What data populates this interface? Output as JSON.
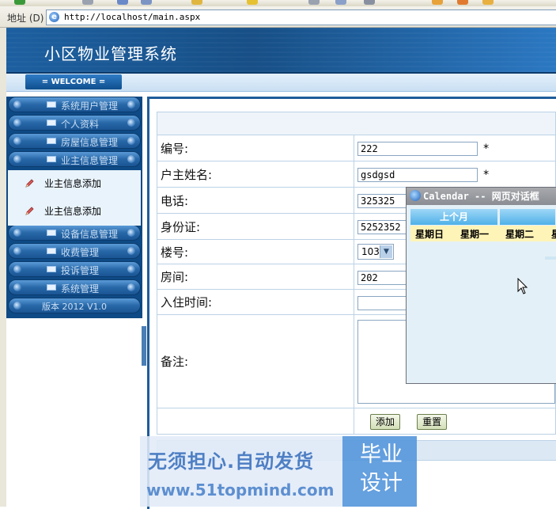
{
  "browser": {
    "address_label": "地址 (D)",
    "url": "http://localhost/main.aspx"
  },
  "header": {
    "system_title": "小区物业管理系统",
    "welcome": "= WELCOME ="
  },
  "sidebar": {
    "items": [
      {
        "label": "系统用户管理"
      },
      {
        "label": "个人资料"
      },
      {
        "label": "房屋信息管理"
      },
      {
        "label": "业主信息管理"
      },
      {
        "label": "设备信息管理"
      },
      {
        "label": "收费管理"
      },
      {
        "label": "投诉管理"
      },
      {
        "label": "系统管理"
      }
    ],
    "submenu": [
      {
        "label": "业主信息添加"
      },
      {
        "label": "业主信息添加"
      }
    ],
    "version": "版本 2012 V1.0"
  },
  "form": {
    "fields": {
      "id": {
        "label": "编号:",
        "value": "222",
        "required": "*"
      },
      "owner": {
        "label": "户主姓名:",
        "value": "gsdgsd",
        "required": "*"
      },
      "phone": {
        "label": "电话:",
        "value": "325325"
      },
      "idcard": {
        "label": "身份证:",
        "value": "5252352"
      },
      "building": {
        "label": "楼号:",
        "value": "103"
      },
      "room": {
        "label": "房间:",
        "value": "202"
      },
      "checkin": {
        "label": "入住时间:",
        "value": ""
      },
      "notes": {
        "label": "备注:"
      }
    },
    "buttons": {
      "add": "添加",
      "reset": "重置"
    }
  },
  "calendar": {
    "title": "Calendar -- 网页对话框",
    "prev_month": "上个月",
    "weekdays": [
      "星期日",
      "星期一",
      "星期二",
      "星"
    ]
  },
  "watermark": {
    "line1": "无须担心.自动发货",
    "line2": "www.51topmind.com",
    "badge": "毕业设计"
  },
  "colors": {
    "banner": "#1c5fa0",
    "sidebar": "#0e4a85",
    "calendar_header": "#4fb1e8",
    "weekday_bar": "#fff4b8"
  }
}
